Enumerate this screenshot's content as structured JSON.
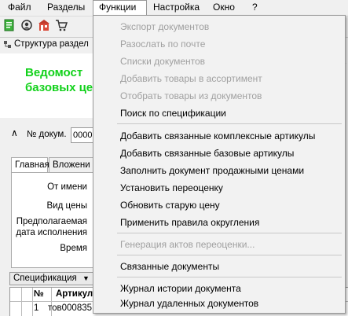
{
  "menubar": {
    "file": "Файл",
    "sections": "Разделы",
    "functions": "Функции",
    "settings": "Настройка",
    "window": "Окно",
    "help": "?"
  },
  "toolbar": {
    "icons": [
      "new-document-icon",
      "gear-person-icon",
      "shop-icon",
      "cart-icon"
    ]
  },
  "structure": {
    "label": "Структура раздел"
  },
  "header": {
    "title_line1": "Ведомост",
    "title_line2": "базовых це"
  },
  "doc": {
    "number_label": "№ докум.",
    "number_value": "0000"
  },
  "tabs": [
    {
      "label": "Главная"
    },
    {
      "label": "Вложени"
    }
  ],
  "fields": {
    "from": "От имени",
    "price_type": "Вид цены",
    "expected_date_line1": "Предполагаемая",
    "expected_date_line2": "дата исполнения",
    "time": "Время"
  },
  "spec": {
    "button": "Спецификация",
    "col_no": "№",
    "col_article": "Артикул",
    "row1_no": "1",
    "row1_article": "тов000835"
  },
  "functions_menu": {
    "items": [
      {
        "label": "Экспорт документов",
        "enabled": false
      },
      {
        "label": "Разослать по почте",
        "enabled": false
      },
      {
        "label": "Списки документов",
        "enabled": false
      },
      {
        "label": "Добавить товары в ассортимент",
        "enabled": false
      },
      {
        "label": "Отобрать товары из документов",
        "enabled": false
      },
      {
        "label": "Поиск по спецификации",
        "enabled": true
      },
      {
        "label": "Добавить связанные комплексные артикулы",
        "enabled": true
      },
      {
        "label": "Добавить связанные базовые артикулы",
        "enabled": true
      },
      {
        "label": "Заполнить документ продажными ценами",
        "enabled": true
      },
      {
        "label": "Установить переоценку",
        "enabled": true
      },
      {
        "label": "Обновить старую цену",
        "enabled": true
      },
      {
        "label": "Применить правила округления",
        "enabled": true
      },
      {
        "label": "Генерация актов переоценки...",
        "enabled": false
      },
      {
        "label": "Связанные документы",
        "enabled": true
      },
      {
        "label": "Журнал истории документа",
        "enabled": true
      },
      {
        "label": "Журнал удаленных документов",
        "enabled": true
      }
    ]
  },
  "colors": {
    "title_green": "#11d11a",
    "disabled_text": "#a0a0a0"
  }
}
